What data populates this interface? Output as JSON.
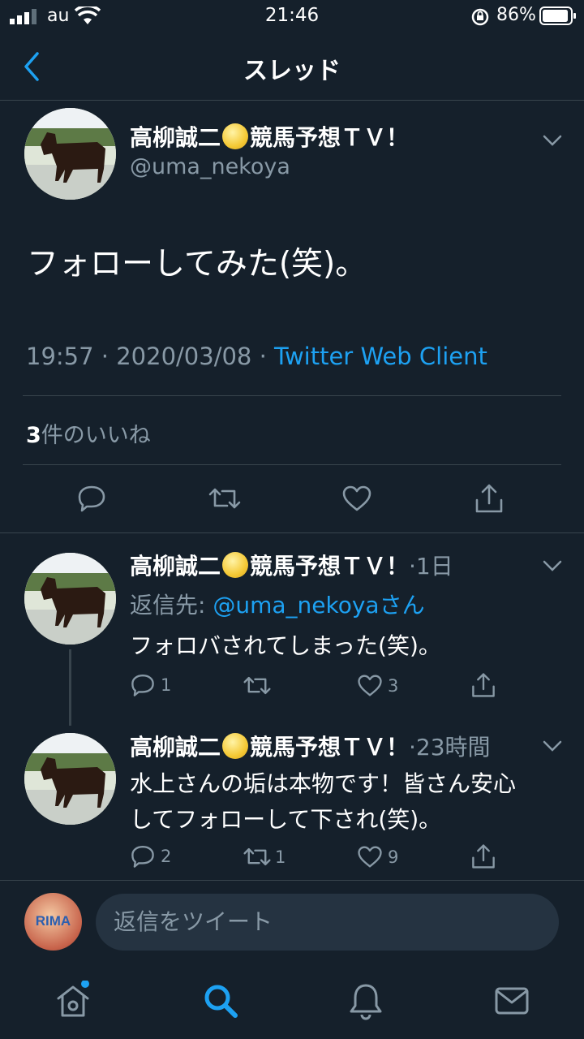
{
  "status_bar": {
    "carrier": "au",
    "time": "21:46",
    "battery": "86%"
  },
  "nav": {
    "title": "スレッド"
  },
  "main_tweet": {
    "author_name": "高柳誠二",
    "author_name_suffix": "競馬予想ＴＶ！",
    "handle": "@uma_nekoya",
    "text": "フォローしてみた(笑)。",
    "timestamp": "19:57 · 2020/03/08 · ",
    "client": "Twitter Web Client",
    "likes_count": "3",
    "likes_label": "件のいいね"
  },
  "replies": [
    {
      "author_name": "高柳誠二",
      "author_name_suffix": "競馬予想ＴＶ！",
      "time": "·1日",
      "reply_to_label": "返信先: ",
      "reply_to_handle": "@uma_nekoyaさん",
      "text": "フォロバされてしまった(笑)。",
      "reply_count": "1",
      "retweet_count": "",
      "like_count": "3"
    },
    {
      "author_name": "高柳誠二",
      "author_name_suffix": "競馬予想ＴＶ！",
      "time": "·23時間",
      "text_line1": "水上さんの垢は本物です！皆さん安心",
      "text_line2": "してフォローして下され(笑)。",
      "reply_count": "2",
      "retweet_count": "1",
      "like_count": "9"
    }
  ],
  "composer": {
    "placeholder": "返信をツイート",
    "avatar_text": "RIMA"
  },
  "icons": {
    "back": "chevron-left-icon",
    "reply": "reply-icon",
    "retweet": "retweet-icon",
    "like": "heart-icon",
    "share": "share-icon",
    "home": "home-icon",
    "search": "search-icon",
    "notifications": "bell-icon",
    "messages": "mail-icon"
  },
  "colors": {
    "background": "#15202b",
    "accent": "#1da1f2",
    "muted": "#8899a6",
    "divider": "#38444d"
  }
}
